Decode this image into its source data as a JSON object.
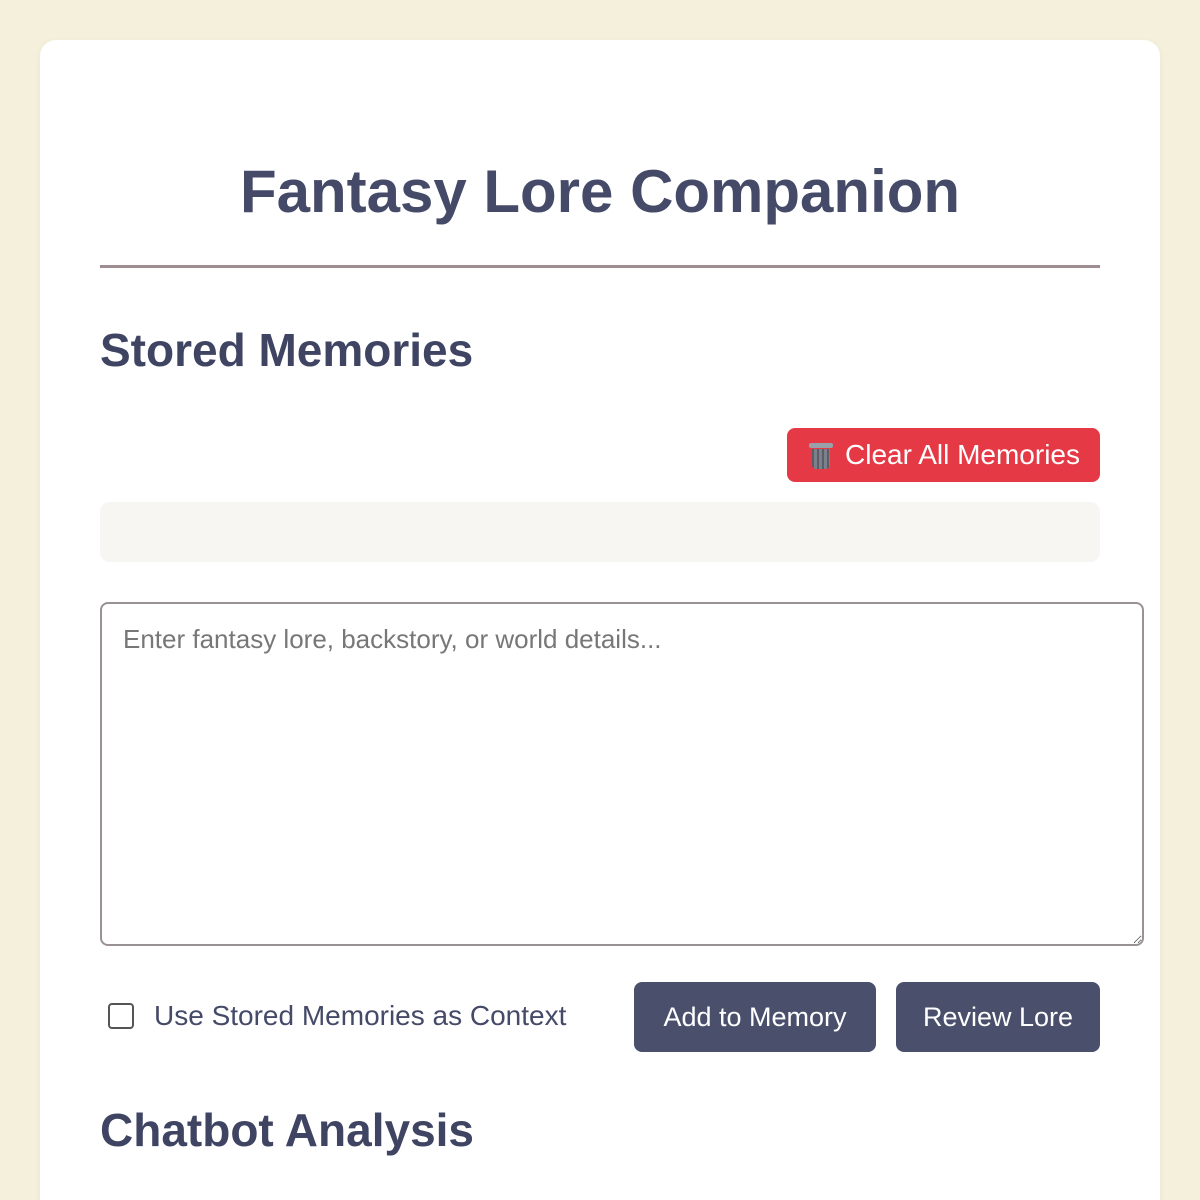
{
  "app": {
    "title": "Fantasy Lore Companion"
  },
  "memories": {
    "heading": "Stored Memories",
    "clear_label": "Clear All Memories",
    "clear_icon": "trash-icon",
    "items": []
  },
  "lore_input": {
    "value": "",
    "placeholder": "Enter fantasy lore, backstory, or world details..."
  },
  "controls": {
    "use_context_label": "Use Stored Memories as Context",
    "use_context_checked": false,
    "add_label": "Add to Memory",
    "review_label": "Review Lore"
  },
  "analysis": {
    "heading": "Chatbot Analysis"
  },
  "colors": {
    "background": "#f5f0dc",
    "card": "#ffffff",
    "heading": "#454a68",
    "danger": "#e63946",
    "primary_button": "#4a4f6c",
    "divider": "#9e8e92"
  }
}
